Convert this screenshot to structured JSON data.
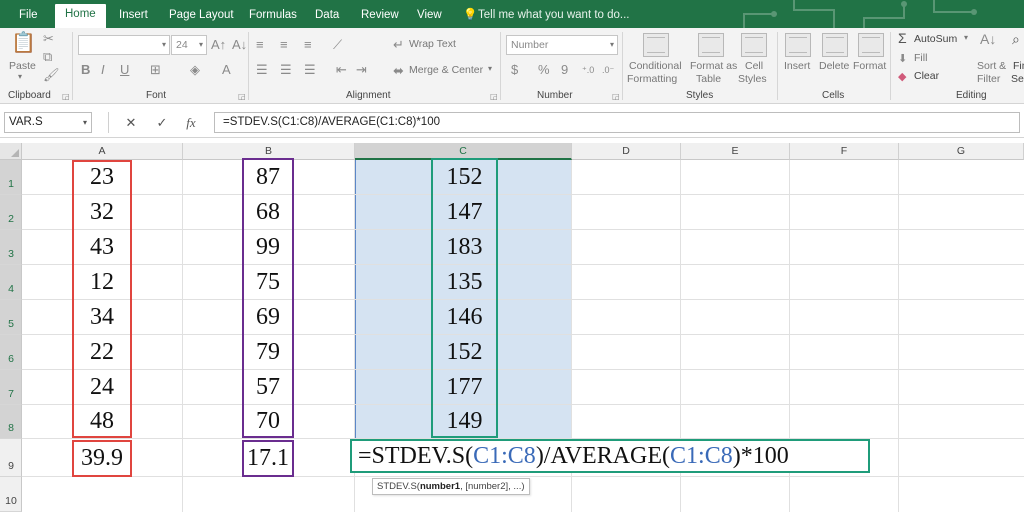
{
  "tabs": [
    "File",
    "Home",
    "Insert",
    "Page Layout",
    "Formulas",
    "Data",
    "Review",
    "View"
  ],
  "active_tab": "Home",
  "tell_me": "Tell me what you want to do...",
  "ribbon": {
    "clipboard": {
      "label": "Clipboard",
      "paste": "Paste"
    },
    "font": {
      "label": "Font",
      "name": "",
      "size": "24",
      "bold": "B",
      "italic": "I",
      "underline": "U"
    },
    "alignment": {
      "label": "Alignment",
      "wrap_text": "Wrap Text",
      "merge_center": "Merge & Center"
    },
    "number": {
      "label": "Number",
      "format": "Number",
      "currency": "$",
      "percent": "%",
      "comma": "9"
    },
    "styles": {
      "label": "Styles",
      "conditional_1": "Conditional",
      "conditional_2": "Formatting",
      "format_as_1": "Format as",
      "format_as_2": "Table",
      "cell_styles_1": "Cell",
      "cell_styles_2": "Styles"
    },
    "cells": {
      "label": "Cells",
      "insert": "Insert",
      "delete": "Delete",
      "format": "Format"
    },
    "editing": {
      "label": "Editing",
      "autosum": "AutoSum",
      "fill": "Fill",
      "clear": "Clear",
      "sort_1": "Sort &",
      "sort_2": "Filter",
      "find_1": "Fin",
      "find_2": "Sel"
    }
  },
  "formula_bar": {
    "name_box": "VAR.S",
    "cancel": "✕",
    "enter": "✓",
    "fx": "fx",
    "formula": "=STDEV.S(C1:C8)/AVERAGE(C1:C8)*100"
  },
  "columns": [
    "A",
    "B",
    "C",
    "D",
    "E",
    "F",
    "G"
  ],
  "rows": [
    "1",
    "2",
    "3",
    "4",
    "5",
    "6",
    "7",
    "8",
    "9",
    "10"
  ],
  "col_a": [
    "23",
    "32",
    "43",
    "12",
    "34",
    "22",
    "24",
    "48"
  ],
  "col_b": [
    "87",
    "68",
    "99",
    "75",
    "69",
    "79",
    "57",
    "70"
  ],
  "col_c": [
    "152",
    "147",
    "183",
    "135",
    "146",
    "152",
    "177",
    "149"
  ],
  "row9": {
    "a": "39.9",
    "b": "17.1"
  },
  "edit_cell": {
    "part1": "=STDEV.S(",
    "ref1": "C1:C8",
    "part2": ")/AVERAGE(",
    "ref2": "C1:C8",
    "part3": ")*100"
  },
  "tooltip": {
    "fn": "STDEV.S(",
    "arg1": "number1",
    "rest": ", [number2], ...)"
  },
  "colors": {
    "excel_green": "#217346",
    "box_red": "#e0453f",
    "box_purple": "#6a2d8f",
    "box_teal": "#1f9c7a",
    "selection": "#d5e3f2",
    "ref_blue": "#3a6ab8"
  }
}
